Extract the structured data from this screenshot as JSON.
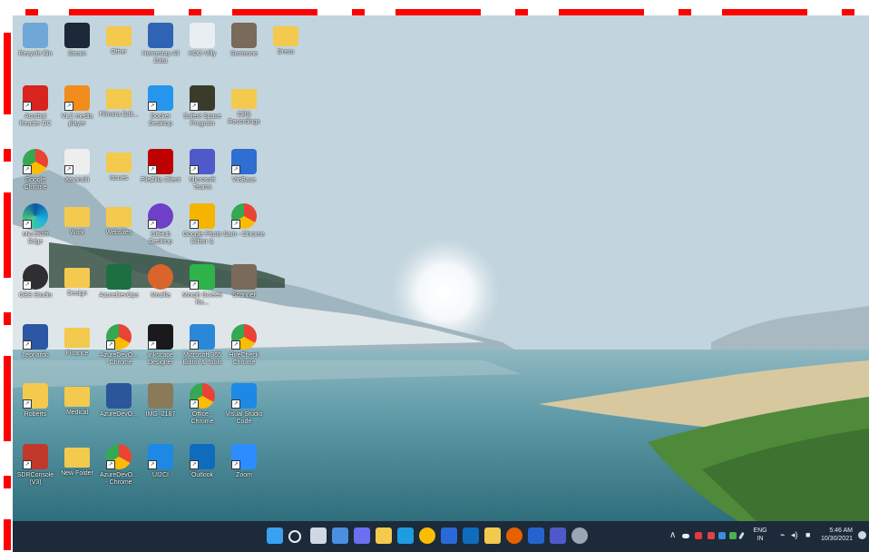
{
  "desktop": {
    "icons": [
      {
        "label": "Recycle Bin",
        "icon": "recycle-bin-icon",
        "color": "#6fa8d6",
        "shortcut": false
      },
      {
        "label": "Steam",
        "icon": "steam-icon",
        "color": "#1b2838",
        "shortcut": false
      },
      {
        "label": "Other",
        "icon": "folder-icon",
        "color": "#f3c94e",
        "shortcut": false
      },
      {
        "label": "Homestay All Data",
        "icon": "document-icon",
        "color": "#2f63b5",
        "shortcut": false
      },
      {
        "label": "HDC-Villy",
        "icon": "emblem-icon",
        "color": "#e9eef2",
        "shortcut": false
      },
      {
        "label": "Someone",
        "icon": "photo-icon",
        "color": "#7a6a5a",
        "shortcut": false
      },
      {
        "label": "Dress",
        "icon": "folder-icon",
        "color": "#f3c94e",
        "shortcut": false
      },
      {
        "label": "Acrobat Reader DC",
        "icon": "acrobat-icon",
        "color": "#d9231f",
        "shortcut": true
      },
      {
        "label": "VLC media player",
        "icon": "vlc-icon",
        "color": "#f28c1c",
        "shortcut": true
      },
      {
        "label": "Filmora Edit...",
        "icon": "folder-icon",
        "color": "#f3c94e",
        "shortcut": false
      },
      {
        "label": "Docker Desktop",
        "icon": "docker-icon",
        "color": "#2496ed",
        "shortcut": true
      },
      {
        "label": "Safest Space Program",
        "icon": "bulb-icon",
        "color": "#3b3b2b",
        "shortcut": true
      },
      {
        "label": "OBS Recordings",
        "icon": "folder-icon",
        "color": "#f3c94e",
        "shortcut": false
      },
      {
        "label": "Google Chrome",
        "icon": "chrome-icon",
        "color": "#4285f4",
        "shortcut": true
      },
      {
        "label": "Xmanski",
        "icon": "x-icon",
        "color": "#eeeeee",
        "shortcut": true
      },
      {
        "label": "Issues",
        "icon": "folder-icon",
        "color": "#f3c94e",
        "shortcut": false
      },
      {
        "label": "FileZilla Client",
        "icon": "filezilla-icon",
        "color": "#bf0000",
        "shortcut": true
      },
      {
        "label": "Microsoft Teams",
        "icon": "teams-icon",
        "color": "#5059c9",
        "shortcut": true
      },
      {
        "label": "VirtBase",
        "icon": "chart-icon",
        "color": "#2e6fd1",
        "shortcut": true
      },
      {
        "label": "Microsoft Edge",
        "icon": "edge-icon",
        "color": "#1f9be0",
        "shortcut": true
      },
      {
        "label": "Work",
        "icon": "folder-icon",
        "color": "#f3c94e",
        "shortcut": false
      },
      {
        "label": "Websites",
        "icon": "folder-icon",
        "color": "#f3c94e",
        "shortcut": false
      },
      {
        "label": "GitHub Desktop",
        "icon": "github-icon",
        "color": "#6e40c9",
        "shortcut": true
      },
      {
        "label": "Google Photo Editor &",
        "icon": "photos-icon",
        "color": "#f4b400",
        "shortcut": true
      },
      {
        "label": "Sam - Chrome",
        "icon": "chrome-profile-icon",
        "color": "#4285f4",
        "shortcut": true
      },
      {
        "label": "OBS Studio",
        "icon": "obs-icon",
        "color": "#302e31",
        "shortcut": true
      },
      {
        "label": "Design",
        "icon": "folder-icon",
        "color": "#f3c94e",
        "shortcut": false
      },
      {
        "label": "AzureDevOps",
        "icon": "excel-icon",
        "color": "#1d6f42",
        "shortcut": false
      },
      {
        "label": "Mozilla",
        "icon": "orb-icon",
        "color": "#d9642c",
        "shortcut": false
      },
      {
        "label": "Morph Screen Re...",
        "icon": "recorder-icon",
        "color": "#2db34a",
        "shortcut": true
      },
      {
        "label": "Scanner",
        "icon": "photo-icon",
        "color": "#7a6a5a",
        "shortcut": false
      },
      {
        "label": "Leonardo",
        "icon": "paint-icon",
        "color": "#2b57a4",
        "shortcut": true
      },
      {
        "label": "Finance",
        "icon": "folder-icon",
        "color": "#f3c94e",
        "shortcut": false
      },
      {
        "label": "AzureDevO... - Chrome",
        "icon": "chrome-profile-icon",
        "color": "#4285f4",
        "shortcut": true
      },
      {
        "label": "Inkscape Designer",
        "icon": "wand-icon",
        "color": "#1a1a1a",
        "shortcut": true
      },
      {
        "label": "Microsoft 365 Editor & Tools",
        "icon": "screen-icon",
        "color": "#2b88d8",
        "shortcut": true
      },
      {
        "label": "HireCheck Chrome",
        "icon": "chrome-profile-icon",
        "color": "#4285f4",
        "shortcut": true
      },
      {
        "label": "Roberts",
        "icon": "user-folder-icon",
        "color": "#f3c94e",
        "shortcut": true
      },
      {
        "label": "Medical",
        "icon": "folder-icon",
        "color": "#f3c94e",
        "shortcut": false
      },
      {
        "label": "AzureDevO...",
        "icon": "word-icon",
        "color": "#2b579a",
        "shortcut": false
      },
      {
        "label": "IMG_2187",
        "icon": "image-icon",
        "color": "#8a7a5a",
        "shortcut": false
      },
      {
        "label": "Office - Chrome",
        "icon": "chrome-profile-icon",
        "color": "#4285f4",
        "shortcut": true
      },
      {
        "label": "Visual Studio Code",
        "icon": "vscode-icon",
        "color": "#1e88e5",
        "shortcut": true
      },
      {
        "label": "SDRConsole (V3)",
        "icon": "antenna-icon",
        "color": "#c0392b",
        "shortcut": true
      },
      {
        "label": "New Folder",
        "icon": "folder-icon",
        "color": "#f3c94e",
        "shortcut": false
      },
      {
        "label": "AzureDevO... - Chrome",
        "icon": "chrome-profile-icon",
        "color": "#4285f4",
        "shortcut": true
      },
      {
        "label": "UI2CI",
        "icon": "vscode-icon",
        "color": "#1e88e5",
        "shortcut": true
      },
      {
        "label": "Outlook",
        "icon": "outlook-icon",
        "color": "#0f6cbd",
        "shortcut": true
      },
      {
        "label": "Zoom",
        "icon": "zoom-icon",
        "color": "#2d8cff",
        "shortcut": true
      }
    ]
  },
  "taskbar": {
    "apps": [
      {
        "name": "start-button-icon",
        "color": "#3aa0f0"
      },
      {
        "name": "search-icon",
        "color": "#e8eef5"
      },
      {
        "name": "task-view-icon",
        "color": "#cfd8e3"
      },
      {
        "name": "widgets-icon",
        "color": "#4a8fe0"
      },
      {
        "name": "chat-icon",
        "color": "#6b6ff0"
      },
      {
        "name": "file-explorer-icon",
        "color": "#f3c94e"
      },
      {
        "name": "edge-icon",
        "color": "#1f9be0"
      },
      {
        "name": "chrome-icon",
        "color": "#fbbc05"
      },
      {
        "name": "store-icon",
        "color": "#2a6ad8"
      },
      {
        "name": "outlook-icon",
        "color": "#0f6cbd"
      },
      {
        "name": "folder-icon",
        "color": "#f3c94e"
      },
      {
        "name": "firefox-icon",
        "color": "#e66000"
      },
      {
        "name": "todo-icon",
        "color": "#2564cf"
      },
      {
        "name": "teams-icon",
        "color": "#5059c9"
      },
      {
        "name": "settings-icon",
        "color": "#9aa6b2"
      }
    ],
    "tray": {
      "language": "ENG",
      "region": "IN",
      "time": "5:46 AM",
      "date": "10/30/2021"
    }
  }
}
